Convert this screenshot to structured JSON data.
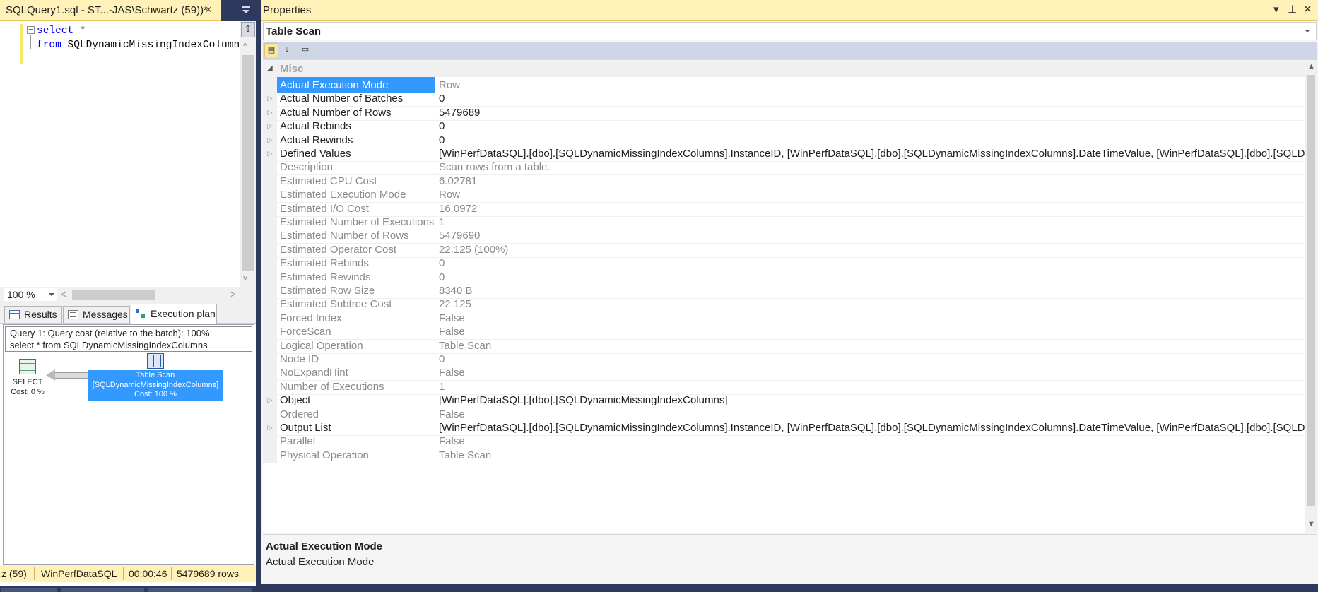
{
  "document_tab": {
    "title": "SQLQuery1.sql - ST...-JAS\\Schwartz (59))*",
    "close": "×"
  },
  "editor": {
    "collapse_glyph": "−",
    "lines": [
      {
        "kw": "select",
        "rest": " *"
      },
      {
        "kw": "from",
        "rest": " SQLDynamicMissingIndexColumns"
      }
    ]
  },
  "zoom": {
    "value": "100 %"
  },
  "results_tabs": [
    {
      "label": "Results",
      "icon": "grid-icon"
    },
    {
      "label": "Messages",
      "icon": "messages-icon"
    },
    {
      "label": "Execution plan",
      "icon": "execution-plan-icon",
      "active": true
    }
  ],
  "plan": {
    "header_line1": "Query 1: Query cost (relative to the batch): 100%",
    "header_line2": "select * from SQLDynamicMissingIndexColumns",
    "select_op": {
      "name": "SELECT",
      "cost": "Cost: 0 %"
    },
    "scan_op": {
      "name": "Table Scan",
      "object": "[SQLDynamicMissingIndexColumns]",
      "cost": "Cost: 100 %"
    }
  },
  "status": {
    "connection": "z (59)",
    "database": "WinPerfDataSQL",
    "elapsed": "00:00:46",
    "rows": "5479689 rows"
  },
  "properties": {
    "title": "Properties",
    "controls": {
      "dropdown": "▾",
      "pin": "⊥",
      "close": "✕"
    },
    "object": "Table Scan",
    "toolbar": [
      "categorized-icon",
      "alphabetical-icon",
      "property-pages-icon"
    ],
    "category": "Misc",
    "rows": [
      {
        "name": "Actual Execution Mode",
        "value": "Row",
        "kind": "ro",
        "selected": true,
        "expand": false
      },
      {
        "name": "Actual Number of Batches",
        "value": "0",
        "kind": "rw",
        "expand": true
      },
      {
        "name": "Actual Number of Rows",
        "value": "5479689",
        "kind": "rw",
        "expand": true
      },
      {
        "name": "Actual Rebinds",
        "value": "0",
        "kind": "rw",
        "expand": true
      },
      {
        "name": "Actual Rewinds",
        "value": "0",
        "kind": "rw",
        "expand": true
      },
      {
        "name": "Defined Values",
        "value": "[WinPerfDataSQL].[dbo].[SQLDynamicMissingIndexColumns].InstanceID, [WinPerfDataSQL].[dbo].[SQLDynamicMissingIndexColumns].DateTimeValue, [WinPerfDataSQL].[dbo].[SQLDyna",
        "kind": "rw",
        "expand": true
      },
      {
        "name": "Description",
        "value": "Scan rows from a table.",
        "kind": "ro",
        "expand": false
      },
      {
        "name": "Estimated CPU Cost",
        "value": "6.02781",
        "kind": "ro",
        "expand": false
      },
      {
        "name": "Estimated Execution Mode",
        "value": "Row",
        "kind": "ro",
        "expand": false
      },
      {
        "name": "Estimated I/O Cost",
        "value": "16.0972",
        "kind": "ro",
        "expand": false
      },
      {
        "name": "Estimated Number of Executions",
        "value": "1",
        "kind": "ro",
        "expand": false
      },
      {
        "name": "Estimated Number of Rows",
        "value": "5479690",
        "kind": "ro",
        "expand": false
      },
      {
        "name": "Estimated Operator Cost",
        "value": "22.125 (100%)",
        "kind": "ro",
        "expand": false
      },
      {
        "name": "Estimated Rebinds",
        "value": "0",
        "kind": "ro",
        "expand": false
      },
      {
        "name": "Estimated Rewinds",
        "value": "0",
        "kind": "ro",
        "expand": false
      },
      {
        "name": "Estimated Row Size",
        "value": "8340 B",
        "kind": "ro",
        "expand": false
      },
      {
        "name": "Estimated Subtree Cost",
        "value": "22.125",
        "kind": "ro",
        "expand": false
      },
      {
        "name": "Forced Index",
        "value": "False",
        "kind": "ro",
        "expand": false
      },
      {
        "name": "ForceScan",
        "value": "False",
        "kind": "ro",
        "expand": false
      },
      {
        "name": "Logical Operation",
        "value": "Table Scan",
        "kind": "ro",
        "expand": false
      },
      {
        "name": "Node ID",
        "value": "0",
        "kind": "ro",
        "expand": false
      },
      {
        "name": "NoExpandHint",
        "value": "False",
        "kind": "ro",
        "expand": false
      },
      {
        "name": "Number of Executions",
        "value": "1",
        "kind": "ro",
        "expand": false
      },
      {
        "name": "Object",
        "value": "[WinPerfDataSQL].[dbo].[SQLDynamicMissingIndexColumns]",
        "kind": "rw",
        "expand": true
      },
      {
        "name": "Ordered",
        "value": "False",
        "kind": "ro",
        "expand": false
      },
      {
        "name": "Output List",
        "value": "[WinPerfDataSQL].[dbo].[SQLDynamicMissingIndexColumns].InstanceID, [WinPerfDataSQL].[dbo].[SQLDynamicMissingIndexColumns].DateTimeValue, [WinPerfDataSQL].[dbo].[SQLDyna",
        "kind": "rw",
        "expand": true
      },
      {
        "name": "Parallel",
        "value": "False",
        "kind": "ro",
        "expand": false
      },
      {
        "name": "Physical Operation",
        "value": "Table Scan",
        "kind": "ro",
        "expand": false
      }
    ],
    "description_title": "Actual Execution Mode",
    "description_text": "Actual Execution Mode"
  },
  "colors": {
    "accent": "#3399ff",
    "tab_yellow": "#fff1b8",
    "chrome_dark": "#2d3a5e",
    "keyword": "#0000ff"
  }
}
